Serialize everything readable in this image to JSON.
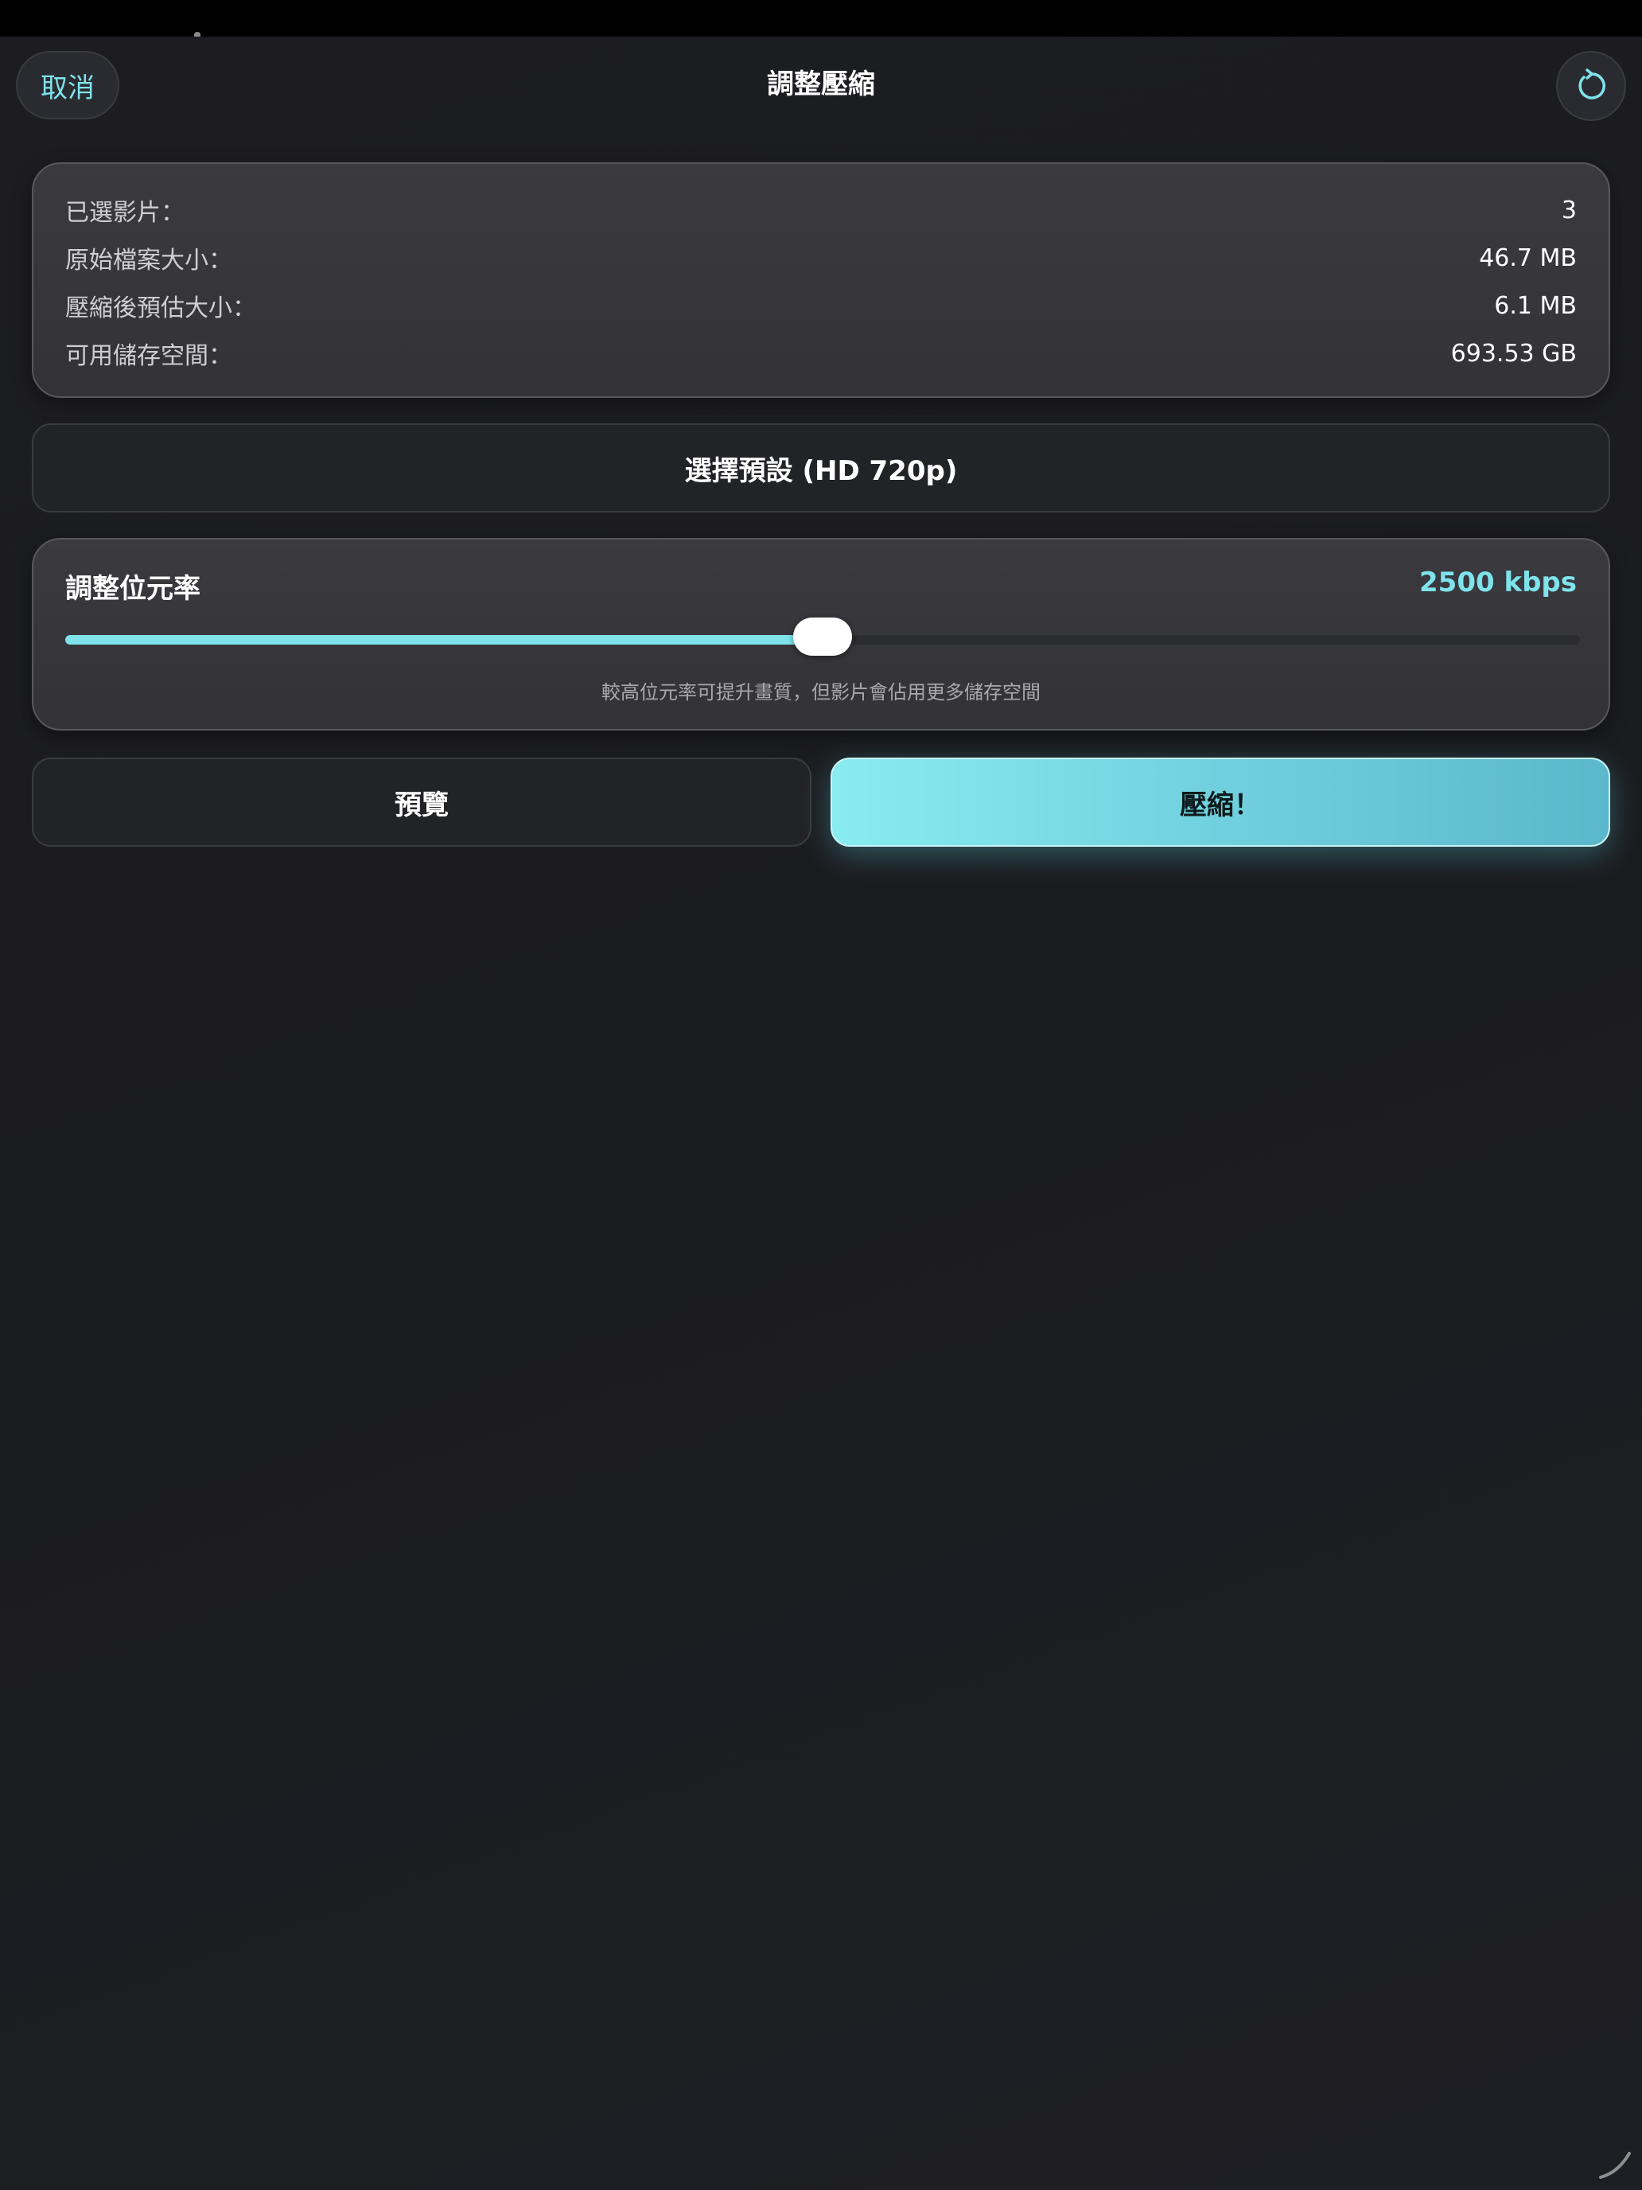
{
  "header": {
    "cancel_label": "取消",
    "title": "調整壓縮",
    "reset_icon": "rotate-ccw-icon"
  },
  "info": {
    "rows": [
      {
        "label": "已選影片：",
        "value": "3"
      },
      {
        "label": "原始檔案大小：",
        "value": "46.7 MB"
      },
      {
        "label": "壓縮後預估大小：",
        "value": "6.1 MB"
      },
      {
        "label": "可用儲存空間：",
        "value": "693.53 GB"
      }
    ]
  },
  "preset": {
    "label": "選擇預設 (HD 720p)"
  },
  "bitrate": {
    "title": "調整位元率",
    "value_text": "2500 kbps",
    "slider_fraction": 0.5,
    "hint": "較高位元率可提升畫質，但影片會佔用更多儲存空間"
  },
  "actions": {
    "preview_label": "預覽",
    "compress_label": "壓縮！"
  },
  "colors": {
    "accent": "#7fe3ec",
    "background": "#1c1d21",
    "card": "#37373c"
  }
}
